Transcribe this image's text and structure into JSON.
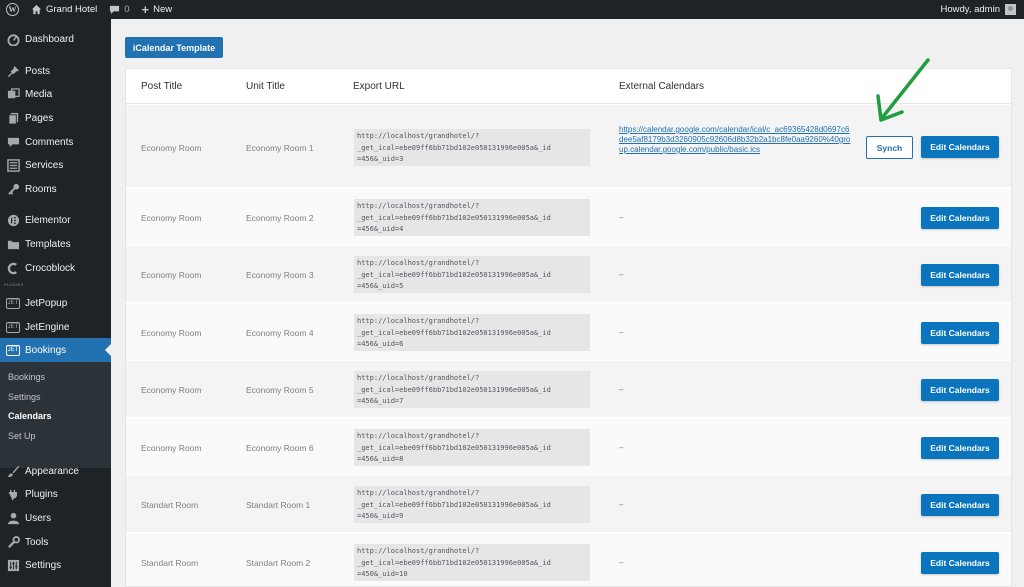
{
  "admin_bar": {
    "site_name": "Grand Hotel",
    "comments_count": "0",
    "new_label": "New",
    "howdy": "Howdy, admin"
  },
  "sidebar": {
    "items": [
      {
        "label": "Dashboard",
        "icon": "dashboard-icon"
      },
      {
        "label": "Posts",
        "icon": "pin-icon"
      },
      {
        "label": "Media",
        "icon": "media-icon"
      },
      {
        "label": "Pages",
        "icon": "pages-icon"
      },
      {
        "label": "Comments",
        "icon": "comments-icon"
      },
      {
        "label": "Services",
        "icon": "services-icon"
      },
      {
        "label": "Rooms",
        "icon": "key-icon"
      },
      {
        "label": "Elementor",
        "icon": "elementor-icon"
      },
      {
        "label": "Templates",
        "icon": "folder-icon"
      },
      {
        "label": "Crocoblock",
        "icon": "crocoblock-icon"
      },
      {
        "label": "JetPopup",
        "icon": "jet-icon"
      },
      {
        "label": "JetEngine",
        "icon": "jet-icon"
      },
      {
        "label": "Bookings",
        "icon": "jet-icon"
      },
      {
        "label": "Appearance",
        "icon": "brush-icon"
      },
      {
        "label": "Plugins",
        "icon": "plug-icon"
      },
      {
        "label": "Users",
        "icon": "user-icon"
      },
      {
        "label": "Tools",
        "icon": "wrench-icon"
      },
      {
        "label": "Settings",
        "icon": "settings-icon"
      }
    ],
    "plugins_tag": "PLUGINS",
    "submenu": [
      "Bookings",
      "Settings",
      "Calendars",
      "Set Up"
    ]
  },
  "ical_button": "iCalendar Template",
  "table": {
    "headers": [
      "Post Title",
      "Unit Title",
      "Export URL",
      "External Calendars"
    ],
    "rows": [
      {
        "post": "Economy Room",
        "unit": "Economy Room 1",
        "url": "http://localhost/grandhotel/?\n_get_ical=ebe09ff6bb71bd102e050131996e005a&_id\n=456&_uid=3",
        "external": "https://calendar.google.com/calendar/ical/c_ac69365428d0697c6dee5af8179b3d3260905c92606d8b32b2a1bc8fe0aa9260%40group.calendar.google.com/public/basic.ics",
        "synch": "Synch",
        "edit": "Edit Calendars"
      },
      {
        "post": "Economy Room",
        "unit": "Economy Room 2",
        "url": "http://localhost/grandhotel/?\n_get_ical=ebe09ff6bb71bd102e050131996e005a&_id\n=456&_uid=4",
        "external": "–",
        "edit": "Edit Calendars"
      },
      {
        "post": "Economy Room",
        "unit": "Economy Room 3",
        "url": "http://localhost/grandhotel/?\n_get_ical=ebe09ff6bb71bd102e050131996e005a&_id\n=456&_uid=5",
        "external": "–",
        "edit": "Edit Calendars"
      },
      {
        "post": "Economy Room",
        "unit": "Economy Room 4",
        "url": "http://localhost/grandhotel/?\n_get_ical=ebe09ff6bb71bd102e050131996e005a&_id\n=456&_uid=6",
        "external": "–",
        "edit": "Edit Calendars"
      },
      {
        "post": "Economy Room",
        "unit": "Economy Room 5",
        "url": "http://localhost/grandhotel/?\n_get_ical=ebe09ff6bb71bd102e050131996e005a&_id\n=456&_uid=7",
        "external": "–",
        "edit": "Edit Calendars"
      },
      {
        "post": "Economy Room",
        "unit": "Economy Room 6",
        "url": "http://localhost/grandhotel/?\n_get_ical=ebe09ff6bb71bd102e050131996e005a&_id\n=456&_uid=8",
        "external": "–",
        "edit": "Edit Calendars"
      },
      {
        "post": "Standart Room",
        "unit": "Standart Room 1",
        "url": "http://localhost/grandhotel/?\n_get_ical=ebe09ff6bb71bd102e050131996e005a&_id\n=450&_uid=9",
        "external": "–",
        "edit": "Edit Calendars"
      },
      {
        "post": "Standart Room",
        "unit": "Standart Room 2",
        "url": "http://localhost/grandhotel/?\n_get_ical=ebe09ff6bb71bd102e050131996e005a&_id\n=450&_uid=10",
        "external": "–",
        "edit": "Edit Calendars"
      }
    ]
  },
  "colors": {
    "accent": "#2271b1",
    "annotation_arrow": "#1e9e3e"
  }
}
